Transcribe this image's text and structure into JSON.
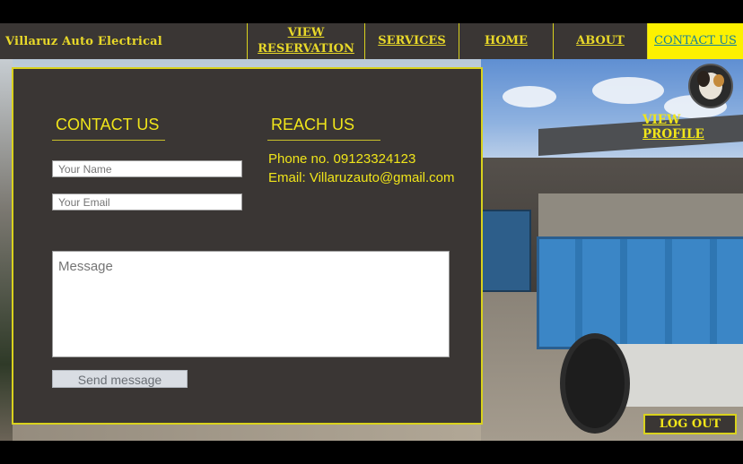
{
  "nav": {
    "brand": "Villaruz Auto Electrical",
    "view_reservation": "VIEW\nRESERVATION",
    "services": "SERVICES",
    "home": "HOME",
    "about": "ABOUT",
    "contact_us": "CONTACT US"
  },
  "contact": {
    "heading": "CONTACT US",
    "name_placeholder": "Your Name",
    "email_placeholder": "Your Email",
    "message_placeholder": "Message",
    "send_label": "Send message"
  },
  "reach": {
    "heading": "REACH US",
    "phone": "Phone no. 09123324123",
    "email": "Email: Villaruzauto@gmail.com"
  },
  "profile": {
    "view_label": "VIEW PROFILE",
    "avatar_icon": "cat-avatar-icon"
  },
  "logout_label": "LOG OUT",
  "colors": {
    "accent_yellow": "#f0e51a",
    "panel_bg": "#3a3634",
    "active_tab_bg": "#fdf100",
    "active_tab_text": "#178099"
  }
}
